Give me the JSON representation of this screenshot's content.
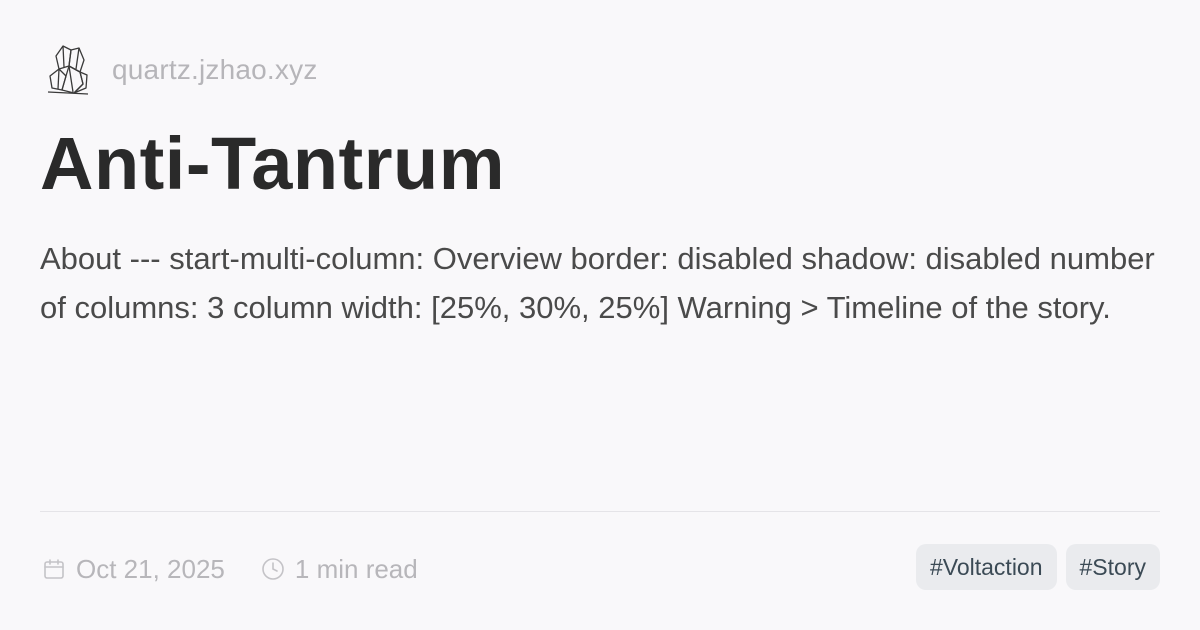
{
  "site": {
    "logo_icon": "crystal-logo-icon",
    "name": "quartz.jzhao.xyz"
  },
  "page": {
    "title": "Anti-Tantrum",
    "description": "About --- start-multi-column: Overview border: disabled shadow: disabled number of columns: 3 column width: [25%, 30%, 25%] Warning > Timeline of the story."
  },
  "meta": {
    "date_icon": "calendar-icon",
    "date": "Oct 21, 2025",
    "read_icon": "clock-icon",
    "reading_time": "1 min read"
  },
  "tags": [
    {
      "label": "#Voltaction"
    },
    {
      "label": "#Story"
    }
  ],
  "colors": {
    "background": "#f9f8fa",
    "title": "#2a2a2a",
    "muted": "#b7b6ba",
    "tag_bg": "#eaebee",
    "tag_text": "#3b4a55"
  }
}
